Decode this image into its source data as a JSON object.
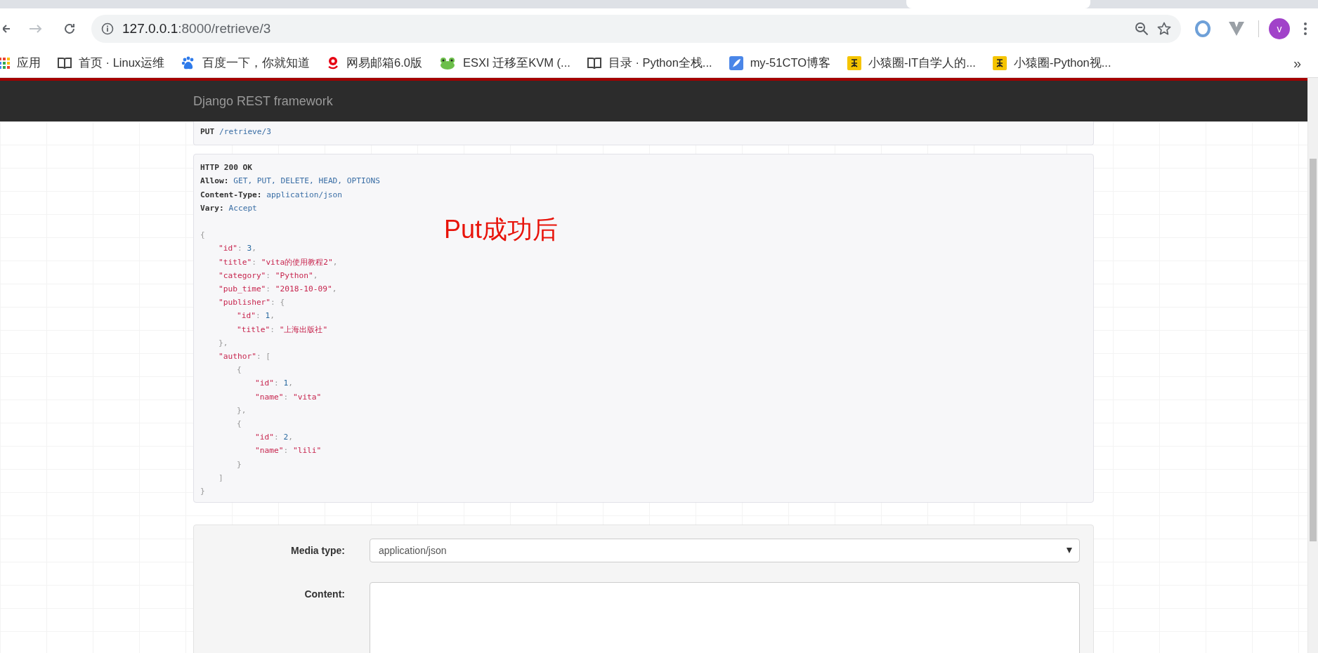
{
  "browser": {
    "url_host": "127.0.0.1",
    "url_path": ":8000/retrieve/3",
    "forward_disabled": true,
    "avatar_letter": "v",
    "bookmarks": [
      {
        "kind": "apps",
        "label": "应用"
      },
      {
        "kind": "book",
        "label": "首页 · Linux运维"
      },
      {
        "kind": "paw",
        "label": "百度一下，你就知道"
      },
      {
        "kind": "mail",
        "label": "网易邮箱6.0版"
      },
      {
        "kind": "frog",
        "label": "ESXI 迁移至KVM (..."
      },
      {
        "kind": "book",
        "label": "目录 · Python全栈..."
      },
      {
        "kind": "feather",
        "label": "my-51CTO博客"
      },
      {
        "kind": "badge",
        "label": "小猿圈-IT自学人的..."
      },
      {
        "kind": "badge",
        "label": "小猿圈-Python视..."
      }
    ],
    "overflow": "»"
  },
  "navbar": {
    "brand": "Django REST framework"
  },
  "request": {
    "method": "PUT",
    "path": "/retrieve/3"
  },
  "response": {
    "status": "HTTP 200 OK",
    "headers": [
      {
        "name": "Allow:",
        "value": "GET, PUT, DELETE, HEAD, OPTIONS"
      },
      {
        "name": "Content-Type:",
        "value": "application/json"
      },
      {
        "name": "Vary:",
        "value": "Accept"
      }
    ],
    "body": [
      {
        "tokens": [
          {
            "kind": "p",
            "text": "{"
          }
        ],
        "children": [
          {
            "tokens": [
              {
                "kind": "k",
                "text": "\"id\""
              },
              {
                "kind": "p",
                "text": ": "
              },
              {
                "kind": "n",
                "text": "3"
              },
              {
                "kind": "p",
                "text": ","
              }
            ]
          },
          {
            "tokens": [
              {
                "kind": "k",
                "text": "\"title\""
              },
              {
                "kind": "p",
                "text": ": "
              },
              {
                "kind": "s",
                "text": "\"vita的使用教程2\""
              },
              {
                "kind": "p",
                "text": ","
              }
            ]
          },
          {
            "tokens": [
              {
                "kind": "k",
                "text": "\"category\""
              },
              {
                "kind": "p",
                "text": ": "
              },
              {
                "kind": "s",
                "text": "\"Python\""
              },
              {
                "kind": "p",
                "text": ","
              }
            ]
          },
          {
            "tokens": [
              {
                "kind": "k",
                "text": "\"pub_time\""
              },
              {
                "kind": "p",
                "text": ": "
              },
              {
                "kind": "s",
                "text": "\"2018-10-09\""
              },
              {
                "kind": "p",
                "text": ","
              }
            ]
          },
          {
            "tokens": [
              {
                "kind": "k",
                "text": "\"publisher\""
              },
              {
                "kind": "p",
                "text": ": {"
              }
            ],
            "children": [
              {
                "tokens": [
                  {
                    "kind": "k",
                    "text": "\"id\""
                  },
                  {
                    "kind": "p",
                    "text": ": "
                  },
                  {
                    "kind": "n",
                    "text": "1"
                  },
                  {
                    "kind": "p",
                    "text": ","
                  }
                ]
              },
              {
                "tokens": [
                  {
                    "kind": "k",
                    "text": "\"title\""
                  },
                  {
                    "kind": "p",
                    "text": ": "
                  },
                  {
                    "kind": "s",
                    "text": "\"上海出版社\""
                  }
                ]
              }
            ]
          },
          {
            "tokens": [
              {
                "kind": "p",
                "text": "},"
              }
            ]
          },
          {
            "tokens": [
              {
                "kind": "k",
                "text": "\"author\""
              },
              {
                "kind": "p",
                "text": ": ["
              }
            ],
            "children": [
              {
                "tokens": [
                  {
                    "kind": "p",
                    "text": "{"
                  }
                ],
                "children": [
                  {
                    "tokens": [
                      {
                        "kind": "k",
                        "text": "\"id\""
                      },
                      {
                        "kind": "p",
                        "text": ": "
                      },
                      {
                        "kind": "n",
                        "text": "1"
                      },
                      {
                        "kind": "p",
                        "text": ","
                      }
                    ]
                  },
                  {
                    "tokens": [
                      {
                        "kind": "k",
                        "text": "\"name\""
                      },
                      {
                        "kind": "p",
                        "text": ": "
                      },
                      {
                        "kind": "s",
                        "text": "\"vita\""
                      }
                    ]
                  }
                ]
              },
              {
                "tokens": [
                  {
                    "kind": "p",
                    "text": "},"
                  }
                ]
              },
              {
                "tokens": [
                  {
                    "kind": "p",
                    "text": "{"
                  }
                ],
                "children": [
                  {
                    "tokens": [
                      {
                        "kind": "k",
                        "text": "\"id\""
                      },
                      {
                        "kind": "p",
                        "text": ": "
                      },
                      {
                        "kind": "n",
                        "text": "2"
                      },
                      {
                        "kind": "p",
                        "text": ","
                      }
                    ]
                  },
                  {
                    "tokens": [
                      {
                        "kind": "k",
                        "text": "\"name\""
                      },
                      {
                        "kind": "p",
                        "text": ": "
                      },
                      {
                        "kind": "s",
                        "text": "\"lili\""
                      }
                    ]
                  }
                ]
              },
              {
                "tokens": [
                  {
                    "kind": "p",
                    "text": "}"
                  }
                ]
              }
            ]
          },
          {
            "tokens": [
              {
                "kind": "p",
                "text": "]"
              }
            ]
          }
        ]
      },
      {
        "tokens": [
          {
            "kind": "p",
            "text": "}"
          }
        ]
      }
    ]
  },
  "annotation": "Put成功后",
  "form": {
    "media_label": "Media type:",
    "media_value": "application/json",
    "content_label": "Content:"
  }
}
